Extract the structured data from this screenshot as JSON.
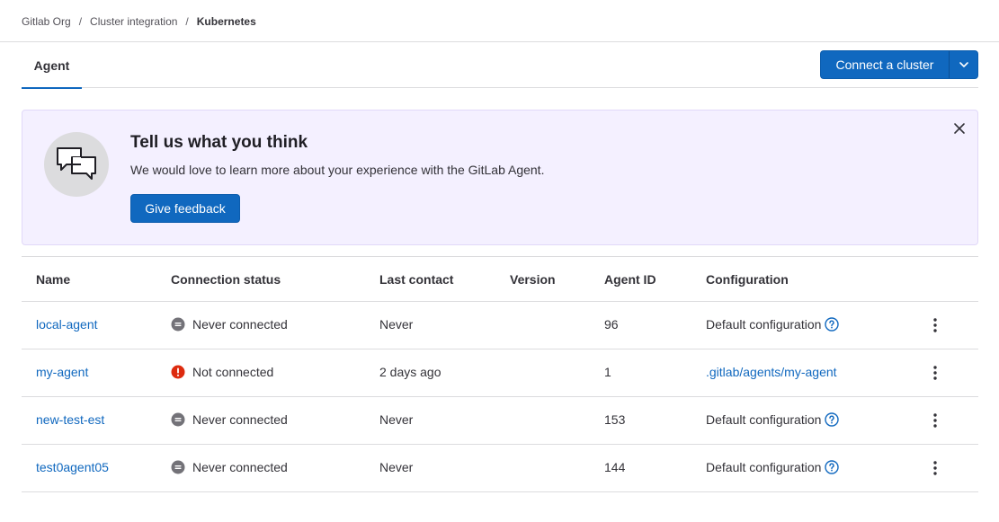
{
  "breadcrumb": {
    "items": [
      "Gitlab Org",
      "Cluster integration"
    ],
    "current": "Kubernetes",
    "separator": "/"
  },
  "tabs": [
    {
      "label": "Agent",
      "active": true
    }
  ],
  "actions": {
    "connect_label": "Connect a cluster",
    "toggle_icon": "chevron-down-icon"
  },
  "banner": {
    "title": "Tell us what you think",
    "text": "We would love to learn more about your experience with the GitLab Agent.",
    "button_label": "Give feedback",
    "illustration": "chat-bubbles-icon",
    "close_icon": "close-icon"
  },
  "table": {
    "columns": [
      "Name",
      "Connection status",
      "Last contact",
      "Version",
      "Agent ID",
      "Configuration"
    ],
    "rows": [
      {
        "name": "local-agent",
        "status": "Never connected",
        "status_kind": "never",
        "last_contact": "Never",
        "version": "",
        "agent_id": "96",
        "config": "Default configuration",
        "config_link": false
      },
      {
        "name": "my-agent",
        "status": "Not connected",
        "status_kind": "error",
        "last_contact": "2 days ago",
        "version": "",
        "agent_id": "1",
        "config": ".gitlab/agents/my-agent",
        "config_link": true
      },
      {
        "name": "new-test-est",
        "status": "Never connected",
        "status_kind": "never",
        "last_contact": "Never",
        "version": "",
        "agent_id": "153",
        "config": "Default configuration",
        "config_link": false
      },
      {
        "name": "test0agent05",
        "status": "Never connected",
        "status_kind": "never",
        "last_contact": "Never",
        "version": "",
        "agent_id": "144",
        "config": "Default configuration",
        "config_link": false
      }
    ]
  },
  "colors": {
    "primary": "#1068bf",
    "error": "#dd2b0e",
    "neutral": "#737278",
    "banner_bg": "#f4f0ff"
  }
}
